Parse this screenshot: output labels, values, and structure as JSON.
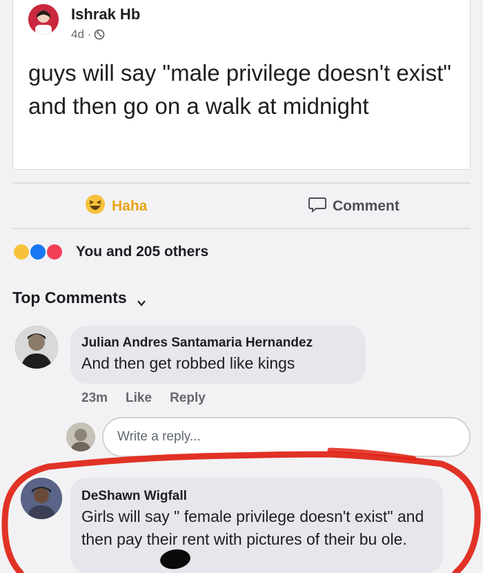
{
  "post": {
    "author": "Ishrak Hb",
    "timestamp": "4d ·",
    "privacy_icon": "globe-icon",
    "text": "guys will say \"male privilege doesn't exist\" and then go on a walk at midnight"
  },
  "actions": {
    "haha_label": "Haha",
    "comment_label": "Comment"
  },
  "reactions": {
    "summary": "You and 205 others",
    "icons": [
      "haha-icon",
      "like-icon",
      "love-icon"
    ]
  },
  "comments_header": {
    "label": "Top Comments"
  },
  "comments": [
    {
      "name": "Julian Andres Santamaria Hernandez",
      "text": "And then get robbed like kings",
      "time": "23m",
      "like_label": "Like",
      "reply_label": "Reply"
    },
    {
      "name": "DeShawn Wigfall",
      "text": "Girls will say \" female privilege doesn't exist\" and then pay their rent with pictures of their bu  ole."
    }
  ],
  "reply": {
    "placeholder": "Write a reply..."
  },
  "colors": {
    "haha": "#e7a514",
    "annotation_circle": "#e02214",
    "like_blue": "#1877f2",
    "love_red": "#f33e58"
  }
}
